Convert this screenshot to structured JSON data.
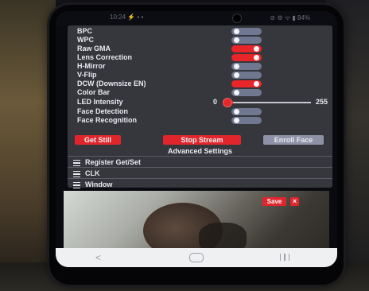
{
  "status_bar": {
    "left_text": "10:24 ⚡ ▪ ▪",
    "right_text": "⊘ ⚙ ᯤ ▮ 84%"
  },
  "settings": {
    "items": [
      {
        "label": "BPC",
        "on": false
      },
      {
        "label": "WPC",
        "on": false
      },
      {
        "label": "Raw GMA",
        "on": true
      },
      {
        "label": "Lens Correction",
        "on": true
      },
      {
        "label": "H-Mirror",
        "on": false
      },
      {
        "label": "V-Flip",
        "on": false
      },
      {
        "label": "DCW (Downsize EN)",
        "on": true
      },
      {
        "label": "Color Bar",
        "on": false
      }
    ],
    "led_intensity": {
      "label": "LED Intensity",
      "min": "0",
      "max": "255",
      "value": 0
    },
    "face_detection": {
      "label": "Face Detection",
      "on": false
    },
    "face_recognition": {
      "label": "Face Recognition",
      "on": false
    }
  },
  "buttons": {
    "get_still": "Get Still",
    "stop_stream": "Stop Stream",
    "enroll_face": "Enroll Face"
  },
  "advanced": {
    "title": "Advanced Settings",
    "menu": [
      {
        "label": "Register Get/Set"
      },
      {
        "label": "CLK"
      },
      {
        "label": "Window"
      }
    ]
  },
  "stream": {
    "save_label": "Save",
    "close_label": "×"
  },
  "navbar": {
    "back_glyph": "<"
  },
  "colors": {
    "accent": "#e8262a",
    "toggle_off": "#6f7890",
    "panel": "#36373d",
    "disabled_button": "#8d92a6"
  }
}
